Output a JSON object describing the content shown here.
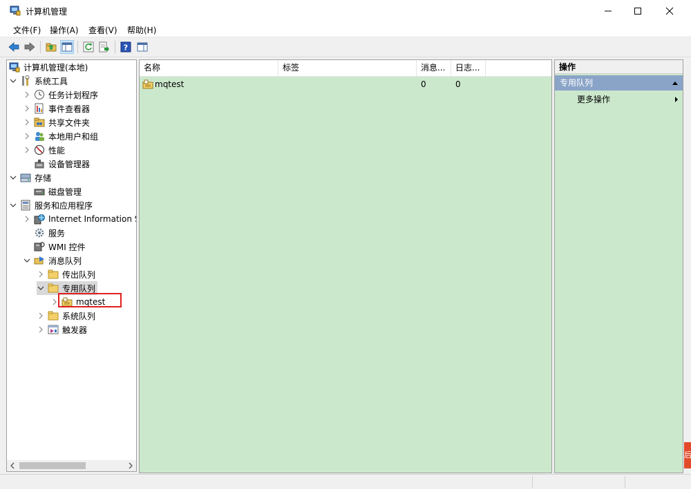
{
  "window": {
    "title": "计算机管理",
    "controls": [
      "minimize",
      "maximize",
      "close"
    ]
  },
  "menu": [
    {
      "label": "文件(F)"
    },
    {
      "label": "操作(A)"
    },
    {
      "label": "查看(V)"
    },
    {
      "label": "帮助(H)"
    }
  ],
  "toolbar": {
    "buttons": [
      "back-icon",
      "forward-icon",
      "up-folder-icon",
      "show-hide-tree-icon",
      "refresh-icon",
      "export-list-icon",
      "help-icon",
      "properties-pane-icon"
    ]
  },
  "tree": {
    "root": "计算机管理(本地)",
    "system_tools": "系统工具",
    "task_scheduler": "任务计划程序",
    "event_viewer": "事件查看器",
    "shared_folders": "共享文件夹",
    "local_users_groups": "本地用户和组",
    "performance": "性能",
    "device_manager": "设备管理器",
    "storage": "存储",
    "disk_management": "磁盘管理",
    "services_apps": "服务和应用程序",
    "iis": "Internet Information S",
    "services": "服务",
    "wmi": "WMI 控件",
    "message_queuing": "消息队列",
    "outgoing_queues": "传出队列",
    "private_queues": "专用队列",
    "mqtest": "mqtest",
    "system_queues": "系统队列",
    "triggers": "触发器"
  },
  "list": {
    "columns": [
      "名称",
      "标签",
      "消息...",
      "日志..."
    ],
    "rows": [
      {
        "name": "mqtest",
        "label": "",
        "messages": "0",
        "journal": "0"
      }
    ]
  },
  "actions": {
    "header": "操作",
    "section": "专用队列",
    "more": "更多操作"
  },
  "edge_fragment": "后"
}
